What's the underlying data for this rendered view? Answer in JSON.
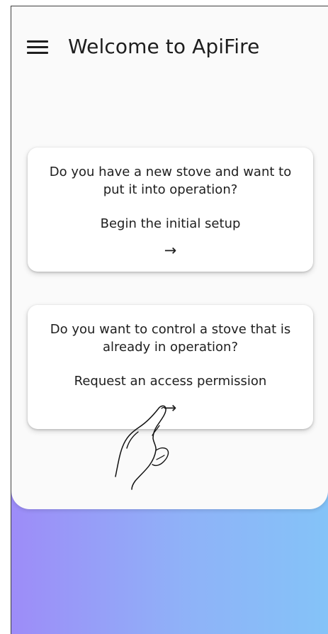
{
  "app": {
    "title": "Welcome to ApiFire"
  },
  "icons": {
    "menu": "menu-icon",
    "arrow": "arrow-right-icon",
    "hand": "hand-pointer-icon"
  },
  "colors": {
    "background_gradient": [
      "#9d8cf8",
      "#84c3f8"
    ],
    "card": "#ffffff",
    "text": "#1e1e1e"
  },
  "cards": [
    {
      "question": "Do you have a new stove and want to put it into operation?",
      "action": "Begin the initial setup",
      "arrow": "→"
    },
    {
      "question": "Do you want to control a stove that is already in operation?",
      "action": "Request an access permission",
      "arrow": "→"
    }
  ]
}
